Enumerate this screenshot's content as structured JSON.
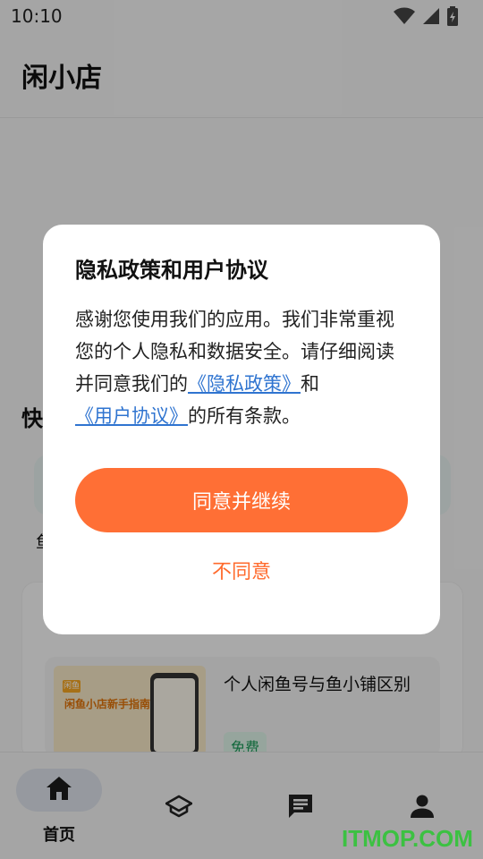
{
  "status_bar": {
    "time": "10:10",
    "icons": [
      "wifi-icon",
      "signal-icon",
      "battery-icon"
    ]
  },
  "header": {
    "title": "闲小店"
  },
  "background": {
    "section_title": "快",
    "quick_label": "鱼",
    "article": {
      "thumb_logo": "闲鱼",
      "thumb_title": "闲鱼小店新手指南",
      "title": "个人闲鱼号与鱼小铺区别",
      "tag": "免费"
    }
  },
  "dialog": {
    "title": "隐私政策和用户协议",
    "body_before": "感谢您使用我们的应用。我们非常重视您的个人隐私和数据安全。请仔细阅读并同意我们的",
    "privacy_link": "《隐私政策》",
    "body_middle": "和",
    "terms_link": "《用户协议》",
    "body_after": "的所有条款。",
    "agree_label": "同意并继续",
    "disagree_label": "不同意"
  },
  "bottom_nav": {
    "items": [
      {
        "label": "首页",
        "icon": "home-icon",
        "active": true
      },
      {
        "label": "",
        "icon": "school-icon",
        "active": false
      },
      {
        "label": "",
        "icon": "message-icon",
        "active": false
      },
      {
        "label": "",
        "icon": "person-icon",
        "active": false
      }
    ]
  },
  "watermark": "ITMOP.COM",
  "colors": {
    "accent": "#ff6f35",
    "link": "#2f74d0",
    "watermark": "#3cc142"
  }
}
